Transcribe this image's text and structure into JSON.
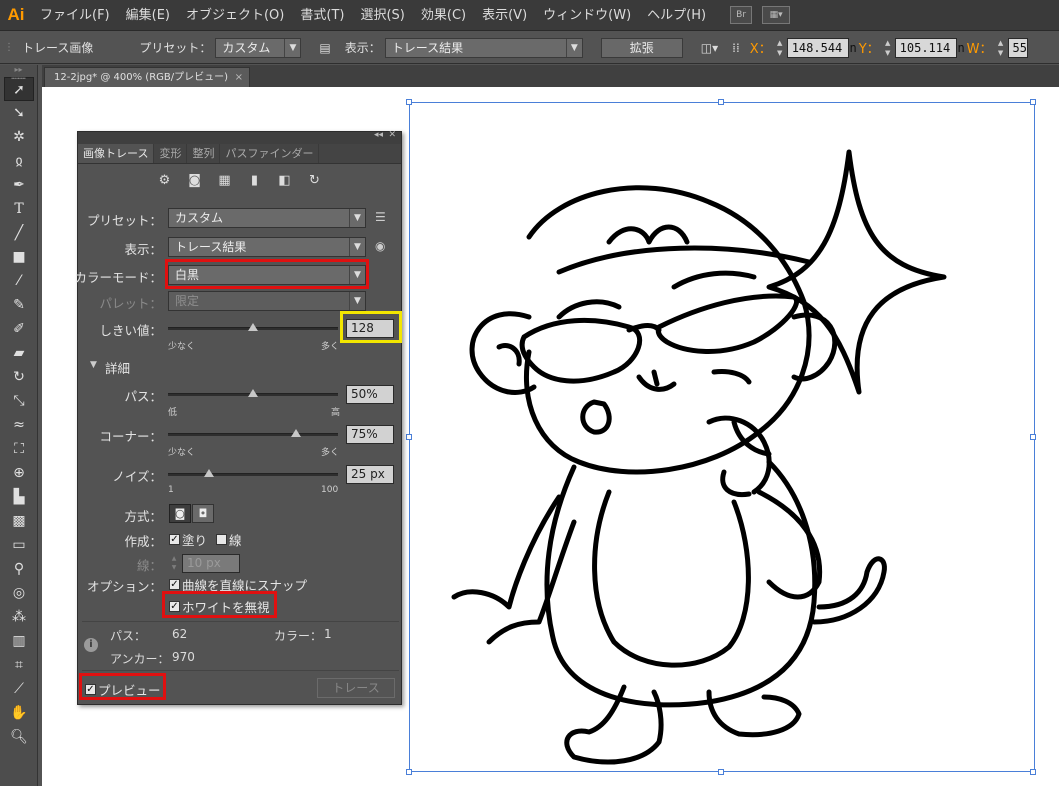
{
  "app": {
    "logo": "Ai"
  },
  "menu": [
    "ファイル(F)",
    "編集(E)",
    "オブジェクト(O)",
    "書式(T)",
    "選択(S)",
    "効果(C)",
    "表示(V)",
    "ウィンドウ(W)",
    "ヘルプ(H)"
  ],
  "menu_icons": {
    "bridge": "Br",
    "arrange": "arrange-documents-icon"
  },
  "control": {
    "object_label": "トレース画像",
    "preset_label": "プリセット：",
    "preset_value": "カスタム",
    "view_label": "表示：",
    "view_value": "トレース結果",
    "expand_button": "拡張",
    "x_label": "X：",
    "x_value": "148.544 n",
    "y_label": "Y：",
    "y_value": "105.114 n",
    "w_label": "W：",
    "w_value": "55."
  },
  "document_tab": {
    "title": "12-2jpg* @ 400% (RGB/プレビュー)",
    "close": "×"
  },
  "panel": {
    "tabs": [
      "画像トレース",
      "変形",
      "整列",
      "パスファインダー"
    ],
    "preset_label": "プリセット：",
    "preset_value": "カスタム",
    "view_label": "表示：",
    "view_value": "トレース結果",
    "mode_label": "カラーモード：",
    "mode_value": "白黒",
    "palette_label": "パレット：",
    "palette_value": "限定",
    "threshold_label": "しきい値：",
    "threshold_value": "128",
    "threshold_fraction": 0.5,
    "threshold_min": "少なく",
    "threshold_max": "多く",
    "details_label": "詳細",
    "paths_label": "パス：",
    "paths_value": "50%",
    "paths_fraction": 0.5,
    "paths_min": "低",
    "paths_max": "高",
    "corners_label": "コーナー：",
    "corners_value": "75%",
    "corners_fraction": 0.75,
    "corners_min": "少なく",
    "corners_max": "多く",
    "noise_label": "ノイズ：",
    "noise_value": "25 px",
    "noise_fraction": 0.24,
    "noise_min": "1",
    "noise_max": "100",
    "method_label": "方式：",
    "create_label": "作成：",
    "fill_label": "塗り",
    "stroke_label": "線",
    "stroke_width_label": "線：",
    "stroke_width_value": "10 px",
    "options_label": "オプション：",
    "snap_label": "曲線を直線にスナップ",
    "ignore_white_label": "ホワイトを無視",
    "info_paths_label": "パス：",
    "info_paths_value": "62",
    "info_colors_label": "カラー：",
    "info_colors_value": "1",
    "info_anchors_label": "アンカー：",
    "info_anchors_value": "970",
    "preview_label": "プレビュー",
    "trace_button": "トレース"
  }
}
